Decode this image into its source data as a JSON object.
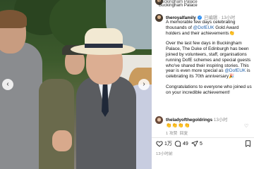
{
  "post": {
    "location_line1": "Buckingham Palace",
    "location_line2": "Buckingham Palace",
    "author": "theroyalfamily",
    "follow_status": "已编辑",
    "time_ago": "13小时",
    "caption": {
      "p1_a": "A memorable few days celebrating thousands of ",
      "p1_mention": "@DofEUK",
      "p1_b": " Gold Award holders and their achievements👏",
      "p2_a": "Over the last few days in Buckingham Palace, The Duke of Edinburgh has been joined by volunteers, staff, organisations running DofE schemes and special guests who've shared their inspiring stories. This year is even more special as ",
      "p2_mention": "@DofEUK",
      "p2_b": " is celebrating its 70th anniversary🎉",
      "p3": "Congratulations to everyone who joined us on your incredible achievement!"
    }
  },
  "comment": {
    "author": "theladyofthegoldrings",
    "time_ago": "13小时",
    "text": "👏👏👏👏",
    "replies": "1 攻赞",
    "reply_label": "回复"
  },
  "actions": {
    "likes": "1万",
    "comments": "49",
    "shares": "5"
  },
  "footer": {
    "date": "13小时前"
  },
  "icons": {
    "like": "heart-icon",
    "comment": "comment-icon",
    "share": "share-icon",
    "bookmark": "bookmark-icon",
    "verified": "verified-badge-icon",
    "more": "more-icon",
    "prev": "chevron-left-icon",
    "next": "chevron-right-icon"
  }
}
